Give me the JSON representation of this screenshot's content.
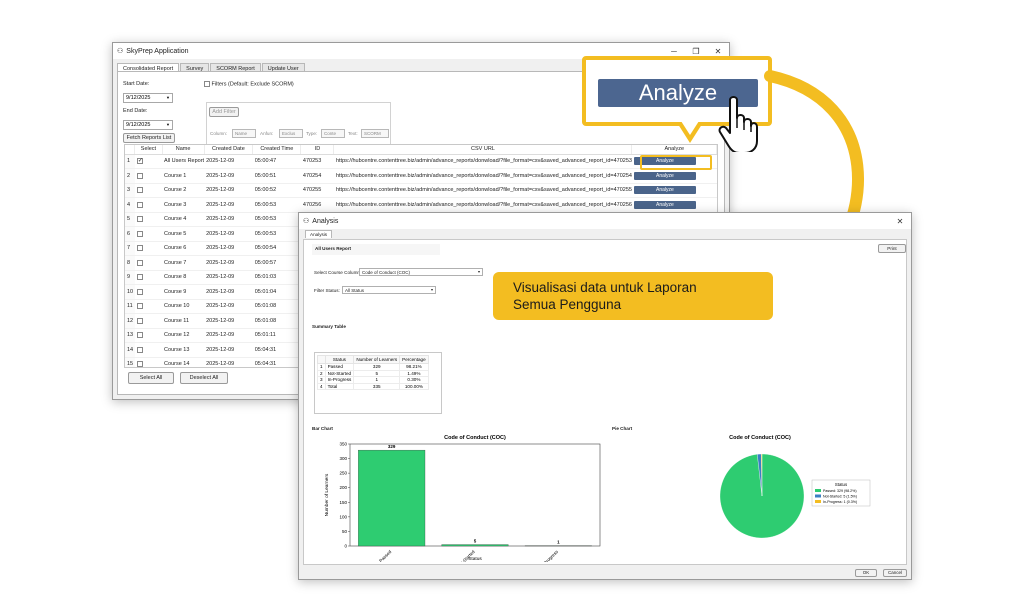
{
  "main_window": {
    "title": "SkyPrep Application",
    "tabs": [
      "Consolidated Report",
      "Survey",
      "SCORM Report",
      "Update User"
    ],
    "start_date_label": "Start Date:",
    "start_date": "9/12/2025",
    "end_date_label": "End Date:",
    "end_date": "9/12/2025",
    "filters_label": "Filters (Default: Exclude SCORM)",
    "add_filter": "Add Filter",
    "filter_row": {
      "column_label": "Column:",
      "column_value": "Name",
      "mid_text": "Anfun:",
      "mid_value": "Exclus",
      "type_label": "Type:",
      "type_value": "Conte",
      "text_label": "Text:",
      "text_value": "SCORM"
    },
    "fetch_button": "Fetch Reports List",
    "table": {
      "headers": [
        "Select",
        "Name",
        "Created Date",
        "Created Time",
        "ID",
        "CSV URL",
        "Analyze"
      ],
      "rows": [
        {
          "n": "1",
          "checked": "✓",
          "name": "All Users Report",
          "date": "2025-12-09",
          "time": "05:00:47",
          "id": "470253",
          "url": "https://hubcentre.contenttree.biz/admin/advance_reports/donwload/?file_format=csv&saved_advanced_report_id=470253",
          "analyze": "Analyze"
        },
        {
          "n": "2",
          "checked": "",
          "name": "Course 1",
          "date": "2025-12-09",
          "time": "05:00:51",
          "id": "470254",
          "url": "https://hubcentre.contenttree.biz/admin/advance_reports/donwload/?file_format=csv&saved_advanced_report_id=470254",
          "analyze": "Analyze"
        },
        {
          "n": "3",
          "checked": "",
          "name": "Course 2",
          "date": "2025-12-09",
          "time": "05:00:52",
          "id": "470255",
          "url": "https://hubcentre.contenttree.biz/admin/advance_reports/donwload/?file_format=csv&saved_advanced_report_id=470255",
          "analyze": "Analyze"
        },
        {
          "n": "4",
          "checked": "",
          "name": "Course 3",
          "date": "2025-12-09",
          "time": "05:00:53",
          "id": "470256",
          "url": "https://hubcentre.contenttree.biz/admin/advance_reports/donwload/?file_format=csv&saved_advanced_report_id=470256",
          "analyze": "Analyze"
        },
        {
          "n": "5",
          "checked": "",
          "name": "Course 4",
          "date": "2025-12-09",
          "time": "05:00:53",
          "id": "",
          "url": "",
          "analyze": ""
        },
        {
          "n": "6",
          "checked": "",
          "name": "Course 5",
          "date": "2025-12-09",
          "time": "05:00:53",
          "id": "",
          "url": "",
          "analyze": ""
        },
        {
          "n": "7",
          "checked": "",
          "name": "Course 6",
          "date": "2025-12-09",
          "time": "05:00:54",
          "id": "",
          "url": "",
          "analyze": ""
        },
        {
          "n": "8",
          "checked": "",
          "name": "Course 7",
          "date": "2025-12-09",
          "time": "05:00:57",
          "id": "",
          "url": "",
          "analyze": ""
        },
        {
          "n": "9",
          "checked": "",
          "name": "Course 8",
          "date": "2025-12-09",
          "time": "05:01:03",
          "id": "",
          "url": "",
          "analyze": ""
        },
        {
          "n": "10",
          "checked": "",
          "name": "Course 9",
          "date": "2025-12-09",
          "time": "05:01:04",
          "id": "",
          "url": "",
          "analyze": ""
        },
        {
          "n": "11",
          "checked": "",
          "name": "Course 10",
          "date": "2025-12-09",
          "time": "05:01:08",
          "id": "",
          "url": "",
          "analyze": ""
        },
        {
          "n": "12",
          "checked": "",
          "name": "Course 11",
          "date": "2025-12-09",
          "time": "05:01:08",
          "id": "",
          "url": "",
          "analyze": ""
        },
        {
          "n": "13",
          "checked": "",
          "name": "Course 12",
          "date": "2025-12-09",
          "time": "05:01:11",
          "id": "",
          "url": "",
          "analyze": ""
        },
        {
          "n": "14",
          "checked": "",
          "name": "Course 13",
          "date": "2025-12-09",
          "time": "05:04:31",
          "id": "",
          "url": "",
          "analyze": ""
        },
        {
          "n": "15",
          "checked": "",
          "name": "Course 14",
          "date": "2025-12-09",
          "time": "05:04:31",
          "id": "",
          "url": "",
          "analyze": ""
        }
      ]
    },
    "select_all": "Select All",
    "deselect_all": "Deselect All"
  },
  "callout": {
    "analyze_label": "Analyze"
  },
  "analysis_window": {
    "title": "Analysis",
    "tab": "Analysis",
    "report_title": "All Users Report",
    "print_button": "Print",
    "select_course_label": "Select Course Column:",
    "select_course_value": "Code of Conduct (COC)",
    "filter_status_label": "Filter Status:",
    "filter_status_value": "All Status",
    "summary_label": "Summary Table",
    "summary": {
      "headers": [
        "Status",
        "Number of Learners",
        "Percentage"
      ],
      "rows": [
        [
          "1",
          "Passed",
          "329",
          "98.21%"
        ],
        [
          "2",
          "Not-Started",
          "5",
          "1.49%"
        ],
        [
          "3",
          "In-Progress",
          "1",
          "0.30%"
        ],
        [
          "4",
          "Total",
          "335",
          "100.00%"
        ]
      ]
    },
    "bar_label": "Bar Chart",
    "pie_label": "Pie Chart",
    "ok": "OK",
    "cancel": "Cancel"
  },
  "note": {
    "line1": "Visualisasi data untuk Laporan",
    "line2": "Semua Pengguna"
  },
  "colors": {
    "accent_yellow": "#f3bd21",
    "bar_green": "#2ecc71",
    "pie_blue": "#3b7fc4",
    "button_blue": "#4a648a"
  },
  "chart_data": [
    {
      "type": "bar",
      "title": "Code of Conduct (COC)",
      "categories": [
        "Passed",
        "Not-Started",
        "In-Progress"
      ],
      "values": [
        329,
        5,
        1
      ],
      "data_labels": [
        "329",
        "5",
        "1"
      ],
      "xlabel": "Status",
      "ylabel": "Number of Learners",
      "yticks": [
        "0",
        "50",
        "100",
        "150",
        "200",
        "250",
        "300",
        "350"
      ],
      "ylim": [
        0,
        350
      ]
    },
    {
      "type": "pie",
      "title": "Code of Conduct (COC)",
      "legend_title": "Status",
      "legend_position": "right",
      "legend": [
        "Passed: 329 (98.2%)",
        "Not-Started: 5 (1.5%)",
        "In-Progress: 1 (0.3%)"
      ],
      "values": [
        329,
        5,
        1
      ],
      "colors": [
        "#2ecc71",
        "#3b7fc4",
        "#f3bd21"
      ]
    }
  ]
}
